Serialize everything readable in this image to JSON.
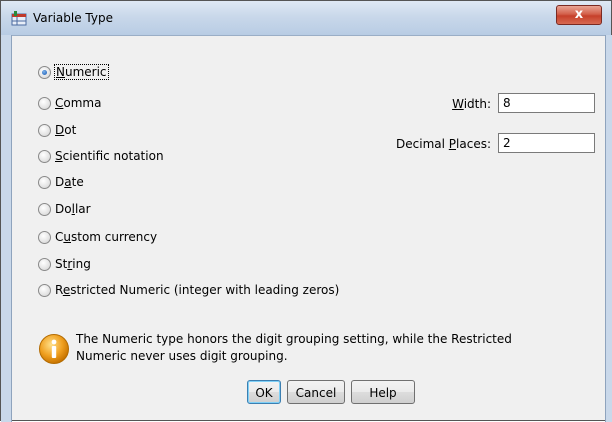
{
  "window": {
    "title": "Variable Type",
    "close_label": "x"
  },
  "types": [
    {
      "label": "Numeric",
      "accel_index": 0,
      "checked": true
    },
    {
      "label": "Comma",
      "accel_index": 0,
      "checked": false
    },
    {
      "label": "Dot",
      "accel_index": 0,
      "checked": false
    },
    {
      "label": "Scientific notation",
      "accel_index": 0,
      "checked": false
    },
    {
      "label": "Date",
      "accel_index": 1,
      "checked": false
    },
    {
      "label": "Dollar",
      "accel_index": 2,
      "checked": false
    },
    {
      "label": "Custom currency",
      "accel_index": 1,
      "checked": false
    },
    {
      "label": "String",
      "accel_index": 2,
      "checked": false
    },
    {
      "label": "Restricted Numeric (integer with leading zeros)",
      "accel_index": 1,
      "checked": false
    }
  ],
  "width": {
    "label": "Width:",
    "accel_index": 0,
    "value": "8"
  },
  "decimal": {
    "label": "Decimal Places:",
    "accel_index": 8,
    "value": "2"
  },
  "info": {
    "icon": "info-icon",
    "line1": "The Numeric type honors the digit grouping setting, while the Restricted",
    "line2": "Numeric never uses digit grouping."
  },
  "buttons": {
    "ok": "OK",
    "cancel": "Cancel",
    "help": "Help"
  },
  "colors": {
    "accent": "#2f6fc2",
    "close": "#c6402a",
    "info": "#f0a020"
  }
}
